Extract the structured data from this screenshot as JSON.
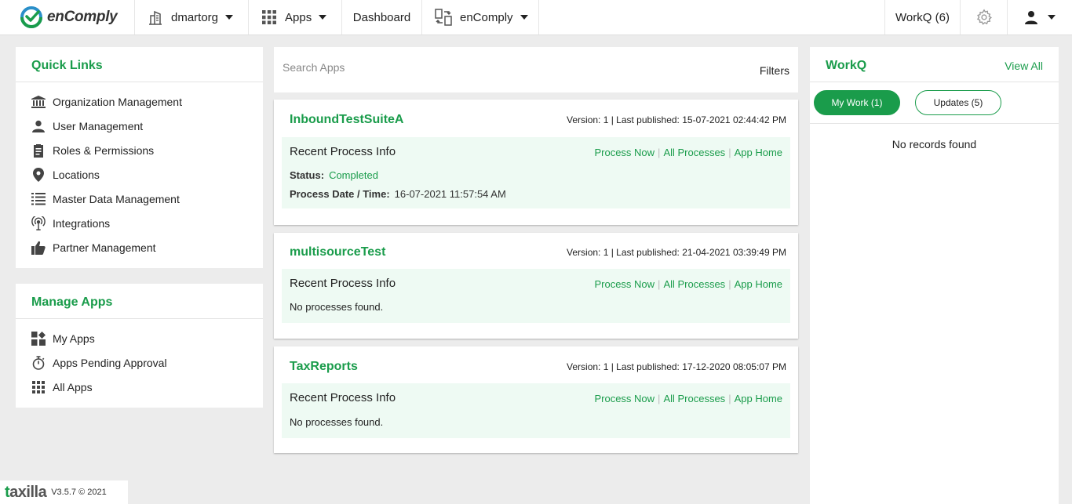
{
  "topbar": {
    "logo_text": "enComply",
    "org": "dmartorg",
    "apps": "Apps",
    "dashboard": "Dashboard",
    "product": "enComply",
    "workq": "WorkQ (6)"
  },
  "quick_links": {
    "title": "Quick Links",
    "items": [
      {
        "label": "Organization Management",
        "icon": "bank-icon"
      },
      {
        "label": "User Management",
        "icon": "user-icon"
      },
      {
        "label": "Roles & Permissions",
        "icon": "clipboard-icon"
      },
      {
        "label": "Locations",
        "icon": "map-pin-icon"
      },
      {
        "label": "Master Data Management",
        "icon": "list-icon"
      },
      {
        "label": "Integrations",
        "icon": "antenna-icon"
      },
      {
        "label": "Partner Management",
        "icon": "thumbs-up-icon"
      }
    ]
  },
  "manage_apps": {
    "title": "Manage Apps",
    "items": [
      {
        "label": "My Apps",
        "icon": "widgets-icon"
      },
      {
        "label": "Apps Pending Approval",
        "icon": "timer-icon"
      },
      {
        "label": "All Apps",
        "icon": "grid-icon"
      }
    ]
  },
  "search": {
    "placeholder": "Search Apps",
    "filters": "Filters"
  },
  "apps_list": [
    {
      "name": "InboundTestSuiteA",
      "meta": "Version: 1 | Last published: 15-07-2021 02:44:42 PM",
      "recent": "Recent Process Info",
      "links": [
        "Process Now",
        "All Processes",
        "App Home"
      ],
      "status_label": "Status:",
      "status": "Completed",
      "date_label": "Process Date / Time:",
      "date": "16-07-2021 11:57:54 AM"
    },
    {
      "name": "multisourceTest",
      "meta": "Version: 1 | Last published: 21-04-2021 03:39:49 PM",
      "recent": "Recent Process Info",
      "links": [
        "Process Now",
        "All Processes",
        "App Home"
      ],
      "empty": "No processes found."
    },
    {
      "name": "TaxReports",
      "meta": "Version: 1 | Last published: 17-12-2020 08:05:07 PM",
      "recent": "Recent Process Info",
      "links": [
        "Process Now",
        "All Processes",
        "App Home"
      ],
      "empty": "No processes found."
    }
  ],
  "workq": {
    "title": "WorkQ",
    "view_all": "View All",
    "tab_my_work": "My Work (1)",
    "tab_updates": "Updates (5)",
    "empty": "No records found"
  },
  "footer": {
    "brand_first": "t",
    "brand_rest": "axilla",
    "version": "V3.5.7 © 2021"
  },
  "colors": {
    "accent": "#1a9c4b",
    "inner_bg": "#eefaf3",
    "page_bg": "#ececec"
  }
}
